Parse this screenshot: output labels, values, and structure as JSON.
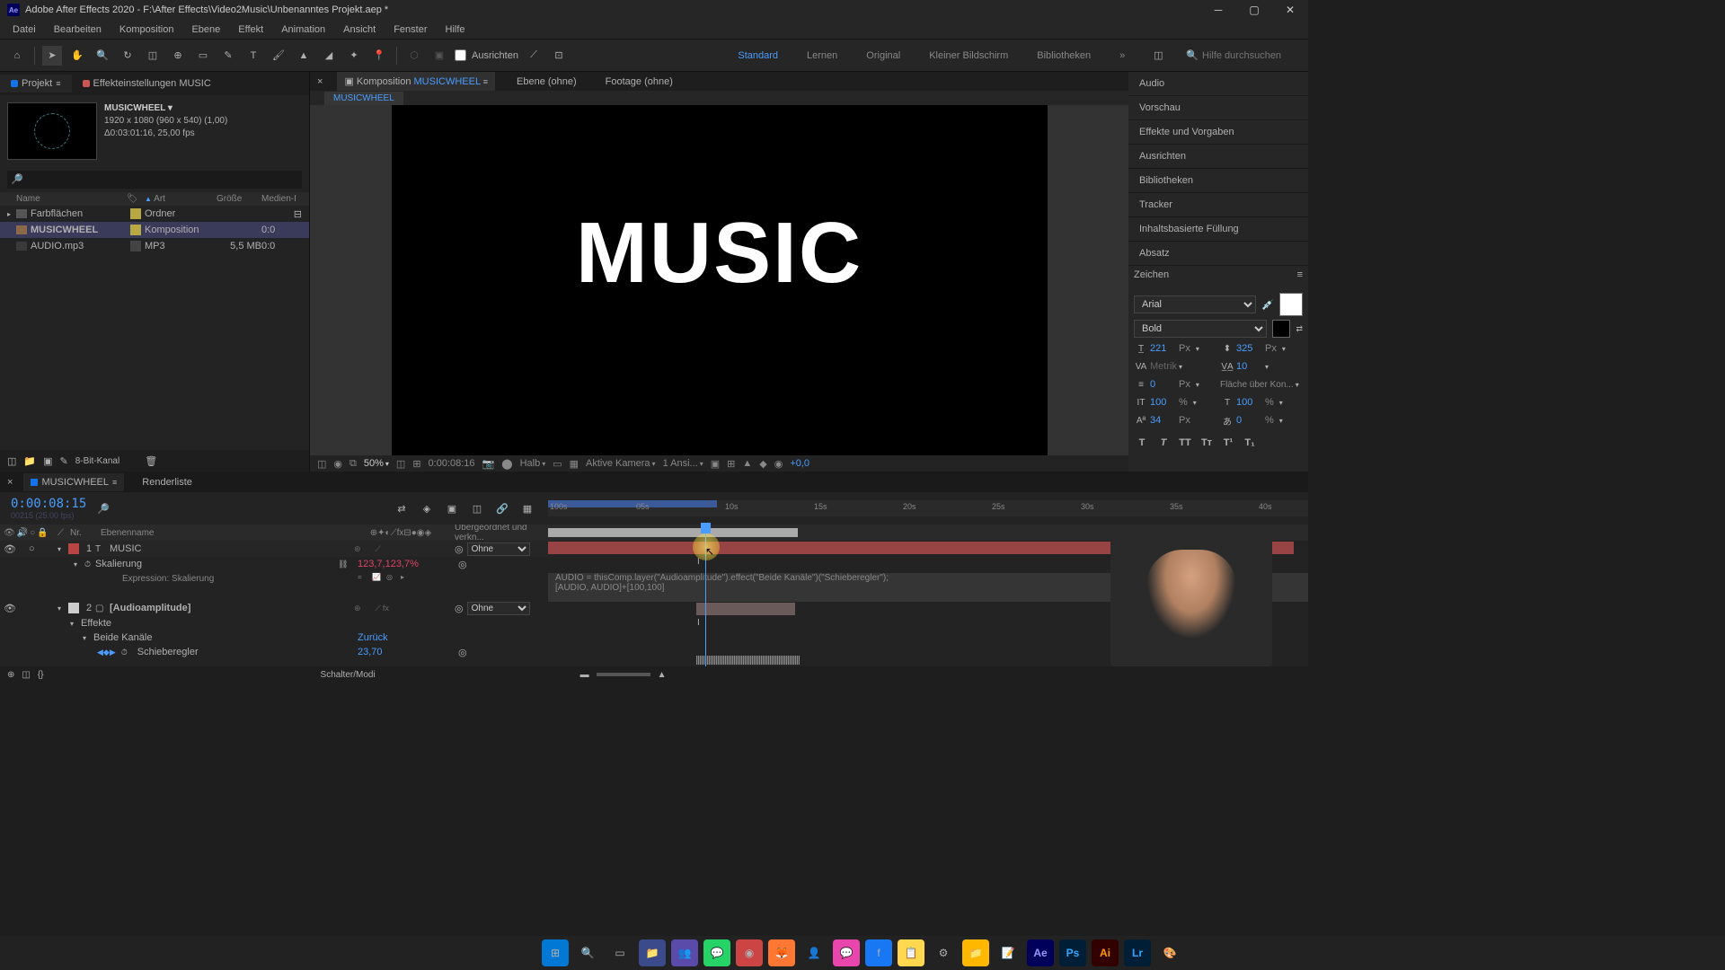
{
  "titlebar": {
    "app": "Adobe After Effects 2020",
    "path": "F:\\After Effects\\Video2Music\\Unbenanntes Projekt.aep *"
  },
  "menu": [
    "Datei",
    "Bearbeiten",
    "Komposition",
    "Ebene",
    "Effekt",
    "Animation",
    "Ansicht",
    "Fenster",
    "Hilfe"
  ],
  "toolbar": {
    "ausrichten": "Ausrichten",
    "workspaces": [
      "Standard",
      "Lernen",
      "Original",
      "Kleiner Bildschirm",
      "Bibliotheken"
    ],
    "search_placeholder": "Hilfe durchsuchen"
  },
  "project_panel": {
    "tabs": {
      "project": "Projekt",
      "effects": "Effekteinstellungen  MUSIC"
    },
    "comp_name": "MUSICWHEEL",
    "comp_dims": "1920 x 1080 (960 x 540) (1,00)",
    "comp_dur": "Δ0:03:01:16, 25,00 fps",
    "cols": {
      "name": "Name",
      "type": "Art",
      "size": "Größe",
      "media": "Medien-I"
    },
    "items": [
      {
        "name": "Farbflächen",
        "type": "Ordner",
        "size": "",
        "dur": ""
      },
      {
        "name": "MUSICWHEEL",
        "type": "Komposition",
        "size": "",
        "dur": "0:0"
      },
      {
        "name": "AUDIO.mp3",
        "type": "MP3",
        "size": "5,5 MB",
        "dur": "0:0"
      }
    ],
    "footer": "8-Bit-Kanal"
  },
  "viewer": {
    "tab_prefix": "Komposition",
    "comp_name": "MUSICWHEEL",
    "ebene": "Ebene  (ohne)",
    "footage": "Footage  (ohne)",
    "subtab": "MUSICWHEEL",
    "canvas_text": "MUSIC",
    "footer": {
      "zoom": "50%",
      "time": "0:00:08:16",
      "quality": "Halb",
      "camera": "Aktive Kamera",
      "view": "1 Ansi...",
      "exposure": "+0,0"
    }
  },
  "right_panels": [
    "Audio",
    "Vorschau",
    "Effekte und Vorgaben",
    "Ausrichten",
    "Bibliotheken",
    "Tracker",
    "Inhaltsbasierte Füllung",
    "Absatz"
  ],
  "zeichen": {
    "title": "Zeichen",
    "font": "Arial",
    "weight": "Bold",
    "size": "221",
    "size_unit": "Px",
    "leading": "325",
    "leading_unit": "Px",
    "kerning": "Metrik",
    "tracking": "10",
    "stroke": "0",
    "stroke_unit": "Px",
    "stroke_opt": "Fläche über Kon...",
    "vscale": "100",
    "vscale_unit": "%",
    "hscale": "100",
    "hscale_unit": "%",
    "baseline": "34",
    "baseline_unit": "Px",
    "tsume": "0",
    "tsume_unit": "%"
  },
  "timeline": {
    "tab": "MUSICWHEEL",
    "renderqueue": "Renderliste",
    "timecode": "0:00:08:15",
    "timecode_sub": "00215 (25.00 fps)",
    "cols": {
      "nr": "Nr.",
      "name": "Ebenenname",
      "parent": "Übergeordnet und verkn..."
    },
    "layers": [
      {
        "num": "1",
        "name": "MUSIC",
        "parent": "Ohne",
        "color": "#b84444"
      },
      {
        "num": "2",
        "name": "[Audioamplitude]",
        "parent": "Ohne",
        "color": "#cccccc"
      }
    ],
    "props": {
      "skalierung": "Skalierung",
      "skalierung_val": "123,7,123,7%",
      "expression": "Expression: Skalierung",
      "effekte": "Effekte",
      "beide_kanale": "Beide Kanäle",
      "zuruck": "Zurück",
      "schieberegler": "Schieberegler",
      "schieberegler_val": "23,70"
    },
    "expr_code1": "AUDIO = thisComp.layer(\"Audioamplitude\").effect(\"Beide Kanäle\")(\"Schieberegler\");",
    "expr_code2": "[AUDIO, AUDIO]+[100,100]",
    "ruler_ticks": [
      "100s",
      "05s",
      "10s",
      "15s",
      "20s",
      "25s",
      "30s",
      "35s",
      "40s"
    ],
    "footer": "Schalter/Modi"
  }
}
